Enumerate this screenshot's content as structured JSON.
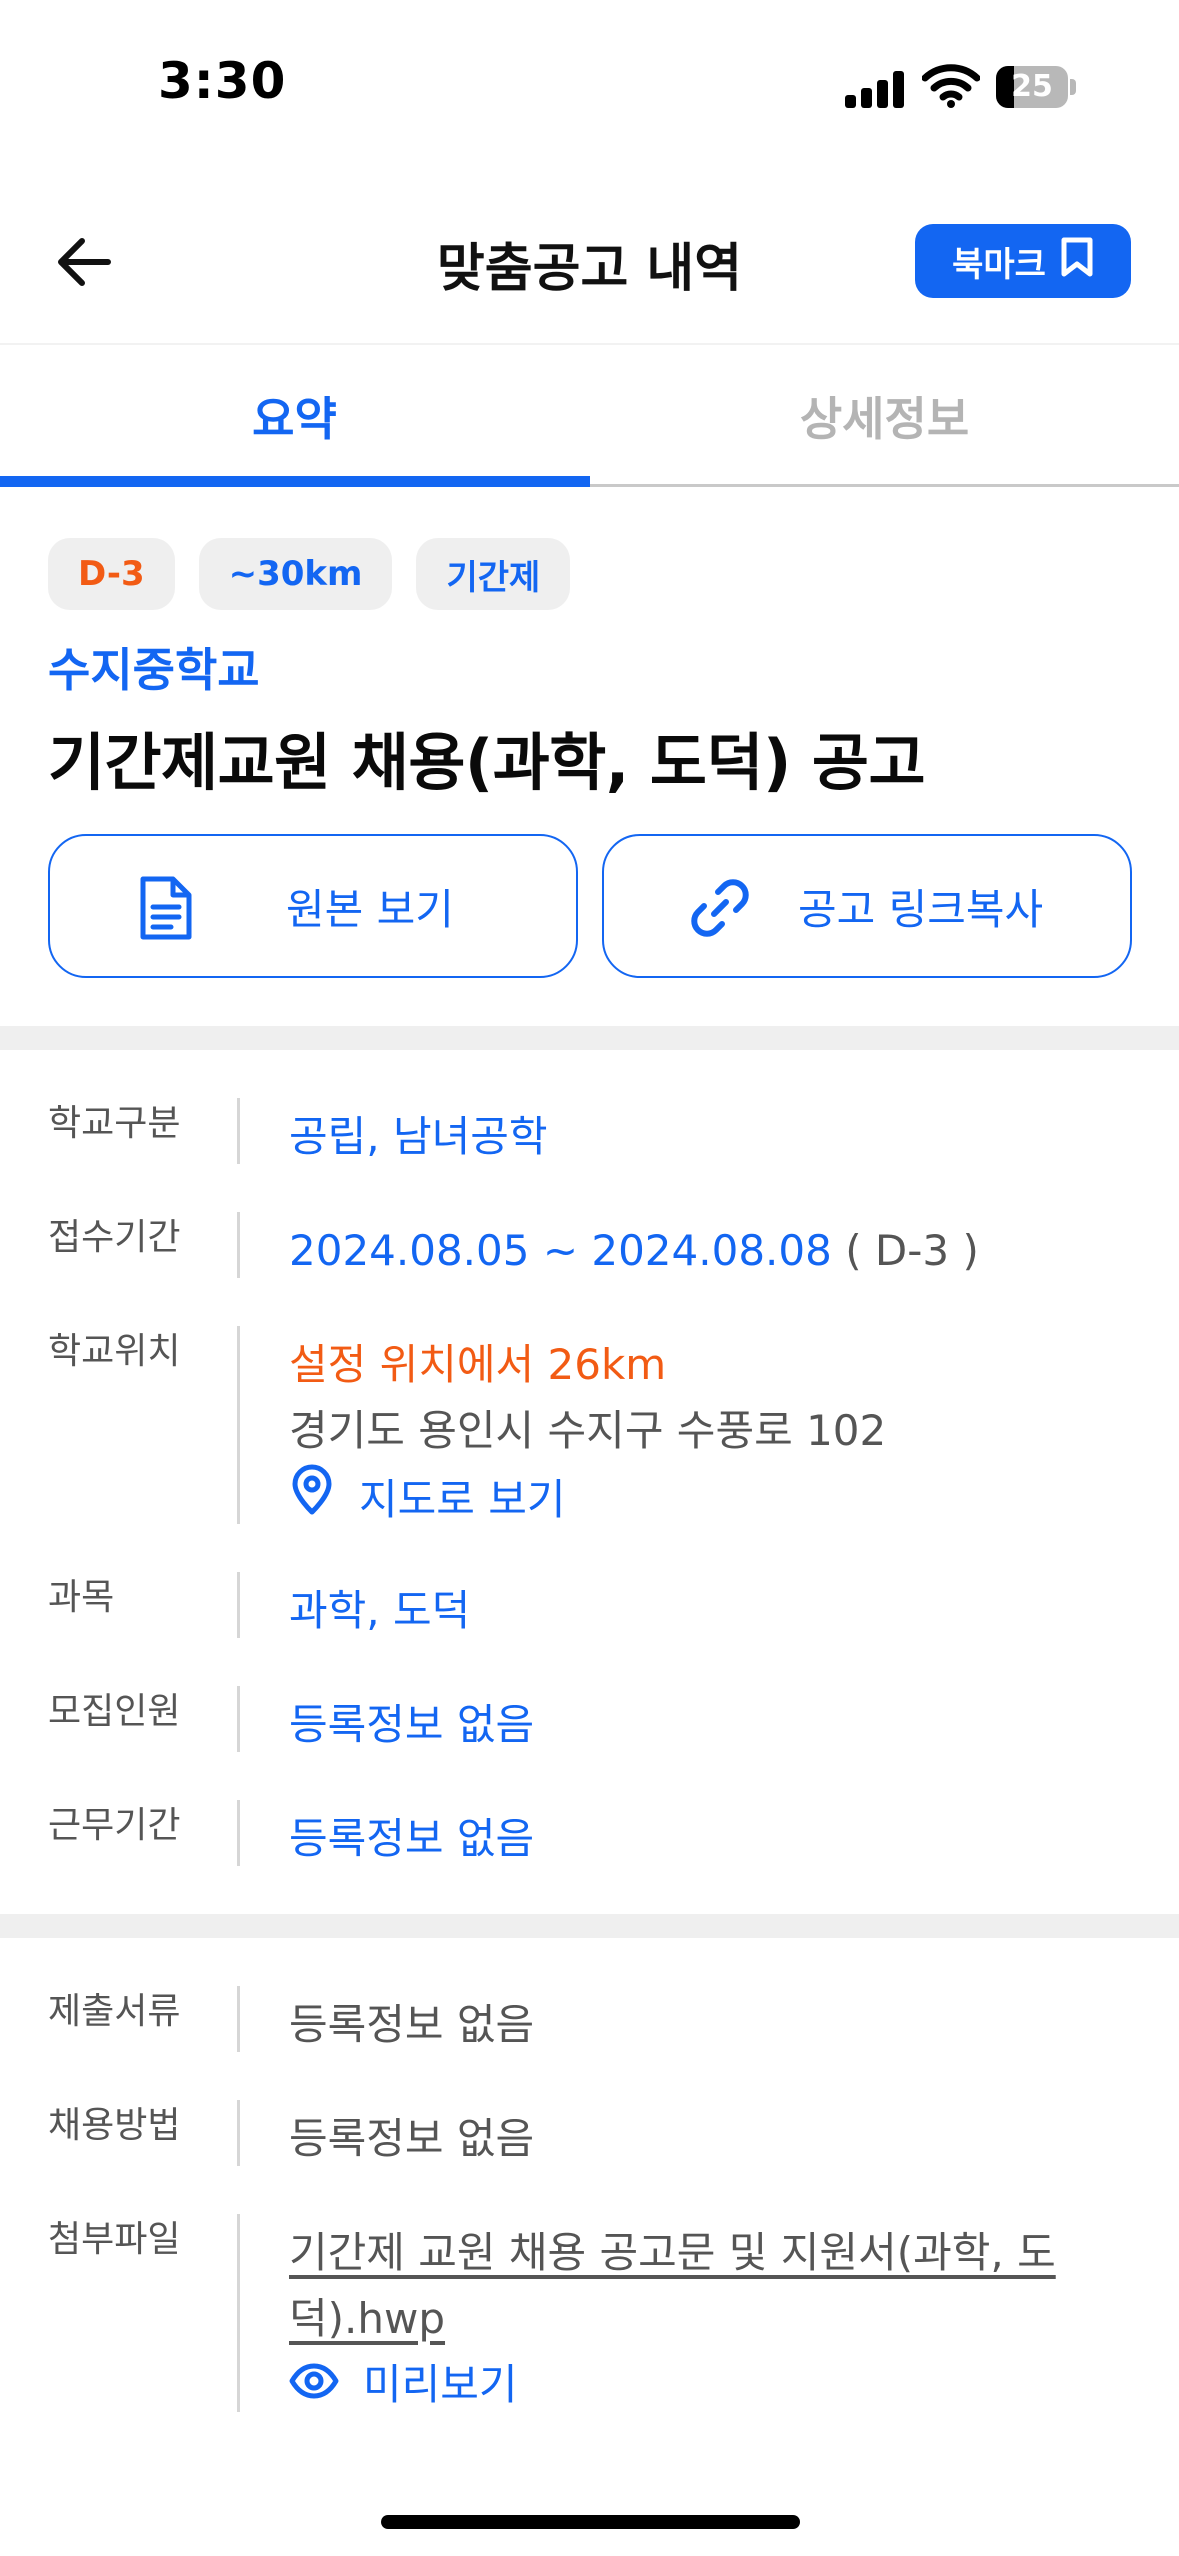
{
  "status_bar": {
    "time": "3:30",
    "battery_level": "25",
    "battery_fraction": 0.25,
    "icons": [
      "signal-icon",
      "wifi-icon",
      "battery-icon"
    ]
  },
  "header": {
    "title": "맞춤공고 내역",
    "bookmark_label": "북마크",
    "back_icon": "arrow-left-icon",
    "bookmark_icon": "bookmark-icon"
  },
  "tabs": [
    {
      "label": "요약",
      "active": true
    },
    {
      "label": "상세정보",
      "active": false
    }
  ],
  "chips": [
    "D-3",
    "~30km",
    "기간제"
  ],
  "school_name": "수지중학교",
  "post_title": "기간제교원 채용(과학, 도덕) 공고",
  "actions": {
    "view_original": "원본 보기",
    "copy_link": "공고 링크복사"
  },
  "info": {
    "school_type": {
      "label": "학교구분",
      "value": "공립, 남녀공학"
    },
    "period": {
      "label": "접수기간",
      "value": "2024.08.05 ~ 2024.08.08",
      "suffix": " ( D-3 )"
    },
    "location": {
      "label": "학교위치",
      "distance": "설정 위치에서 26km",
      "address": "경기도 용인시 수지구 수풍로 102",
      "map_link": "지도로 보기"
    },
    "subject": {
      "label": "과목",
      "value": "과학, 도덕"
    },
    "recruit_count": {
      "label": "모집인원",
      "value": "등록정보 없음"
    },
    "work_period": {
      "label": "근무기간",
      "value": "등록정보 없음"
    },
    "documents": {
      "label": "제출서류",
      "value": "등록정보 없음"
    },
    "method": {
      "label": "채용방법",
      "value": "등록정보 없음"
    },
    "attachment": {
      "label": "첨부파일",
      "file_line1": "기간제 교원 채용 공고문 및 지원서(과학,    도",
      "file_line2": "덕).hwp",
      "preview": "미리보기"
    }
  },
  "colors": {
    "accent": "#1366f2",
    "dday": "#f25b14",
    "chip_bg": "#efefef",
    "label": "#555555"
  }
}
